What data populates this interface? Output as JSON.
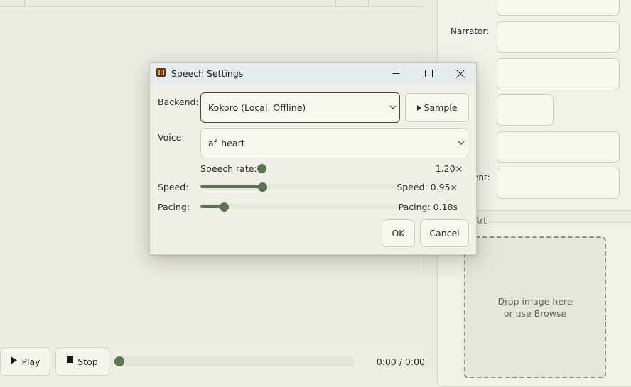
{
  "app": {
    "transport": {
      "play_label": "Play",
      "stop_label": "Stop",
      "position": 0.0,
      "time": "0:00 / 0:00"
    },
    "metadata": {
      "narrator_label": "Narrator:",
      "partial_label": "ent:",
      "art_section_label": "Art",
      "drop_text_line1": "Drop image here",
      "drop_text_line2": "or use Browse"
    }
  },
  "dialog": {
    "title": "Speech Settings",
    "backend": {
      "label": "Backend:",
      "value": "Kokoro (Local, Offline)",
      "sample_label": "Sample"
    },
    "voice": {
      "label": "Voice:",
      "value": "af_heart"
    },
    "speech_rate": {
      "label": "Speech rate:",
      "value_text": "1.20×",
      "level": 0.0
    },
    "speed": {
      "label": "Speed:",
      "value_text": "Speed: 0.95×",
      "level": 0.22
    },
    "pacing": {
      "label": "Pacing:",
      "value_text": "Pacing: 0.18s",
      "level": 0.09
    },
    "ok_label": "OK",
    "cancel_label": "Cancel"
  },
  "colors": {
    "accent": "#5a7550",
    "background": "#edede4",
    "titlebar": "#e4ecef"
  }
}
